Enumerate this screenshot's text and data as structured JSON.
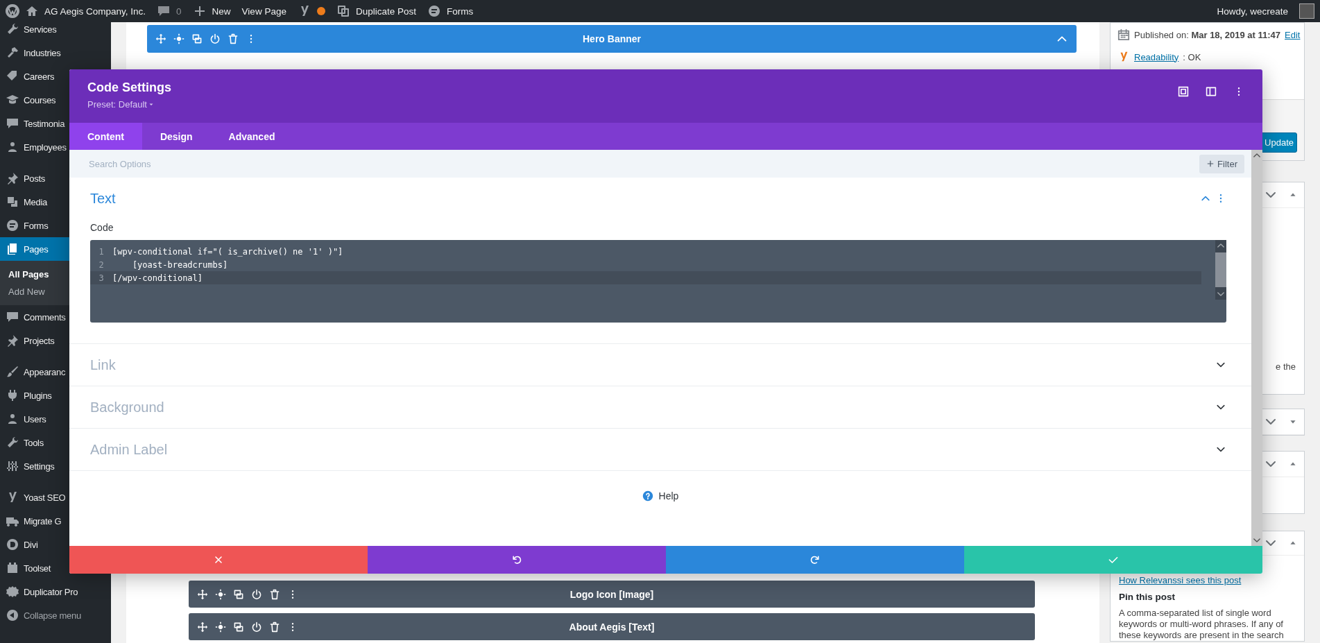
{
  "admin_bar": {
    "site": "AG Aegis Company, Inc.",
    "comments": "0",
    "new": "New",
    "view": "View Page",
    "duplicate": "Duplicate Post",
    "forms": "Forms",
    "greeting": "Howdy, wecreate"
  },
  "sidebar": {
    "groups": [
      {
        "items": [
          {
            "label": "Services",
            "selected": false
          },
          {
            "label": "Industries",
            "selected": false
          },
          {
            "label": "Careers",
            "selected": false
          },
          {
            "label": "Courses",
            "selected": false
          },
          {
            "label": "Testimonia",
            "selected": false
          },
          {
            "label": "Employees",
            "selected": false
          }
        ]
      },
      {
        "items": [
          {
            "label": "Posts",
            "selected": false
          },
          {
            "label": "Media",
            "selected": false
          },
          {
            "label": "Forms",
            "selected": false
          },
          {
            "label": "Pages",
            "selected": true,
            "children": [
              {
                "label": "All Pages",
                "selected": true
              },
              {
                "label": "Add New",
                "selected": false
              }
            ]
          },
          {
            "label": "Comments",
            "selected": false
          },
          {
            "label": "Projects",
            "selected": false
          }
        ]
      },
      {
        "items": [
          {
            "label": "Appearanc",
            "selected": false
          },
          {
            "label": "Plugins",
            "selected": false
          },
          {
            "label": "Users",
            "selected": false
          },
          {
            "label": "Tools",
            "selected": false
          },
          {
            "label": "Settings",
            "selected": false
          }
        ]
      },
      {
        "items": [
          {
            "label": "Yoast SEO",
            "selected": false
          },
          {
            "label": "Migrate G",
            "selected": false
          },
          {
            "label": "Divi",
            "selected": false
          },
          {
            "label": "Toolset",
            "selected": false
          },
          {
            "label": "Duplicator Pro",
            "selected": false
          }
        ]
      }
    ],
    "collapse": "Collapse menu"
  },
  "builder": {
    "hero": "Hero Banner",
    "modules": [
      "Logo Icon [Image]",
      "About Aegis [Text]"
    ]
  },
  "modal": {
    "title": "Code Settings",
    "preset": "Preset: Default",
    "tabs": [
      {
        "label": "Content",
        "selected": true
      },
      {
        "label": "Design",
        "selected": false
      },
      {
        "label": "Advanced",
        "selected": false
      }
    ],
    "search": {
      "placeholder": "Search Options"
    },
    "filter": "Filter",
    "sections": [
      {
        "title": "Text",
        "expanded": true,
        "field_label": "Code",
        "code_lines": [
          {
            "number": "1",
            "text": "[wpv-conditional if=\"( is_archive() ne '1' )\"]",
            "active": false
          },
          {
            "number": "2",
            "text": "    [yoast-breadcrumbs]",
            "active": false
          },
          {
            "number": "3",
            "text": "[/wpv-conditional]",
            "active": true
          }
        ]
      },
      {
        "title": "Link",
        "expanded": false
      },
      {
        "title": "Background",
        "expanded": false
      },
      {
        "title": "Admin Label",
        "expanded": false
      }
    ],
    "help": "Help"
  },
  "right": {
    "published_label": "Published on:",
    "published_date": "Mar 18, 2019 at 11:47",
    "edit": "Edit",
    "readability_link": "Readability",
    "readability_value": ": OK",
    "update": "Update",
    "boxes": [
      {
        "expanded": true,
        "text": "e the"
      },
      {
        "expanded": false
      },
      {
        "expanded": true
      },
      {
        "expanded": true,
        "link": "How Relevanssi sees this post",
        "heading": "Pin this post",
        "paragraph": "A comma-separated list of single word keywords or multi-word phrases. If any of these keywords are present in the search"
      }
    ]
  }
}
